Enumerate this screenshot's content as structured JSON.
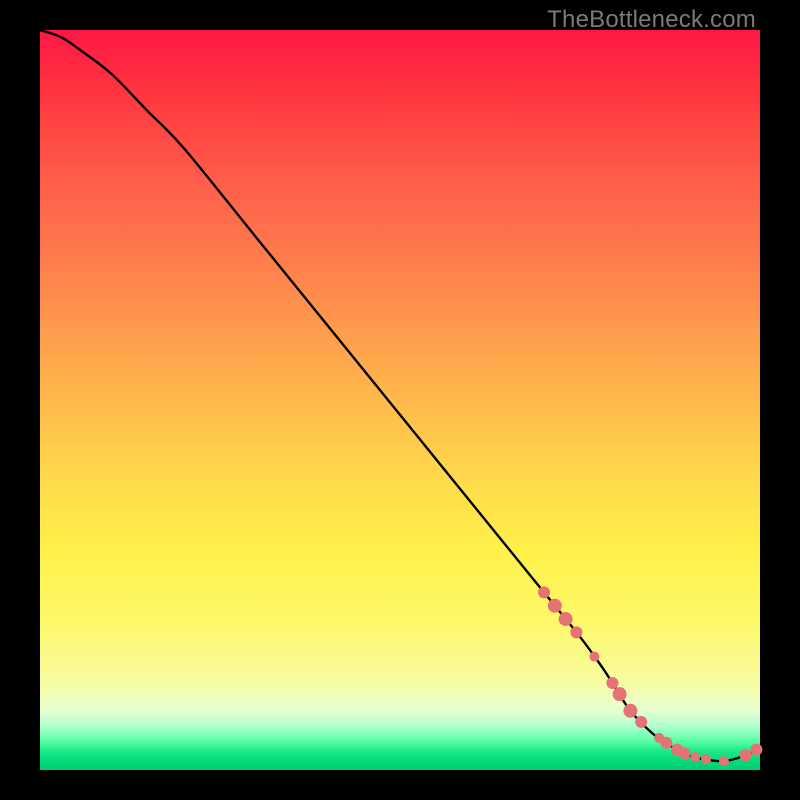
{
  "watermark": "TheBottleneck.com",
  "chart_data": {
    "type": "line",
    "title": "",
    "xlabel": "",
    "ylabel": "",
    "xlim": [
      0,
      100
    ],
    "ylim": [
      0,
      100
    ],
    "grid": false,
    "legend": false,
    "series": [
      {
        "name": "bottleneck-curve",
        "color": "#000000",
        "x": [
          0,
          3,
          6,
          10,
          15,
          20,
          30,
          40,
          50,
          60,
          70,
          75,
          78,
          80,
          82,
          85,
          88,
          90,
          92,
          95,
          98,
          100
        ],
        "values": [
          100,
          99,
          97,
          94,
          89,
          84,
          72,
          60,
          48,
          36,
          24,
          18,
          14,
          11,
          8,
          5,
          3,
          2,
          1.5,
          1.2,
          2,
          3
        ]
      }
    ],
    "markers": {
      "name": "highlighted-points",
      "color": "#e57373",
      "points": [
        {
          "x": 70.0,
          "r": 6
        },
        {
          "x": 71.5,
          "r": 7
        },
        {
          "x": 73.0,
          "r": 7
        },
        {
          "x": 74.5,
          "r": 6
        },
        {
          "x": 77.0,
          "r": 5
        },
        {
          "x": 79.5,
          "r": 6
        },
        {
          "x": 80.5,
          "r": 7
        },
        {
          "x": 82.0,
          "r": 7
        },
        {
          "x": 83.5,
          "r": 6
        },
        {
          "x": 86.0,
          "r": 5
        },
        {
          "x": 87.0,
          "r": 6
        },
        {
          "x": 88.5,
          "r": 6
        },
        {
          "x": 89.5,
          "r": 6
        },
        {
          "x": 91.0,
          "r": 5
        },
        {
          "x": 92.5,
          "r": 5
        },
        {
          "x": 95.0,
          "r": 5
        },
        {
          "x": 98.0,
          "r": 6
        },
        {
          "x": 99.5,
          "r": 6
        }
      ]
    }
  }
}
